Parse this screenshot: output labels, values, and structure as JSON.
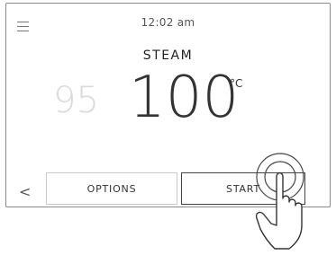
{
  "header": {
    "time": "12:02 am",
    "menu_icon": "hamburger-icon"
  },
  "mode": {
    "name": "STEAM"
  },
  "temperature": {
    "previous": "95",
    "current": "100",
    "unit": "°C"
  },
  "footer": {
    "back_icon": "chevron-left-icon",
    "back_glyph": "<",
    "options_label": "OPTIONS",
    "start_label": "START"
  },
  "overlay": {
    "hand_icon": "tap-hand-icon"
  }
}
